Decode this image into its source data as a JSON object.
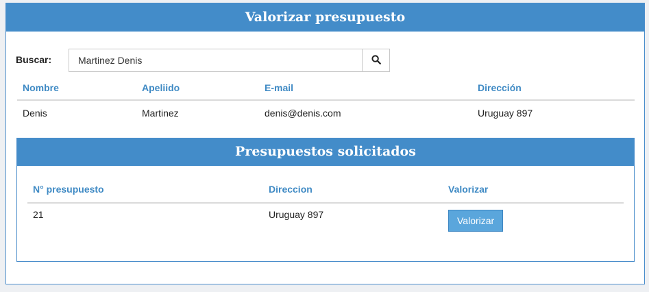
{
  "panel": {
    "title": "Valorizar presupuesto"
  },
  "search": {
    "label": "Buscar:",
    "value": "Martinez Denis",
    "button_icon": "search-icon"
  },
  "clients_table": {
    "headers": [
      "Nombre",
      "Apeliido",
      "E-mail",
      "Dirección"
    ],
    "rows": [
      [
        "Denis",
        "Martinez",
        "denis@denis.com",
        "Uruguay 897"
      ]
    ]
  },
  "quotes_panel": {
    "title": "Presupuestos solicitados",
    "headers": [
      "N° presupuesto",
      "Direccion",
      "Valorizar"
    ],
    "rows": [
      {
        "number": "21",
        "address": "Uruguay 897",
        "action_label": "Valorizar"
      }
    ]
  },
  "colors": {
    "primary": "#438cc9",
    "header_text": "#3f8ac4",
    "button": "#5aa6dc"
  }
}
